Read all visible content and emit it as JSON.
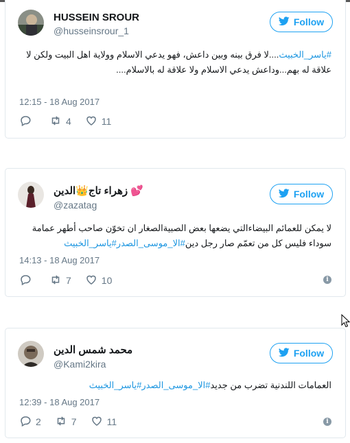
{
  "tweets": [
    {
      "name": "HUSSEIN SROUR",
      "handle": "@husseinsrour_1",
      "follow_label": "Follow",
      "text_hashtag": "#ياسر_الخبيث",
      "text_rest": "....لا فرق بينه وبين داعش، فهو يدعي الاسلام وولاية اهل البيت ولكن لا علاقة له بهم...وداعش يدعي الاسلام ولا علاقة له بالاسلام....",
      "timestamp": "12:15 - 18 Aug 2017",
      "replies": "",
      "retweets": "4",
      "likes": "11"
    },
    {
      "name": "زهراء تاج👑الدين",
      "name_emoji": "💕",
      "handle": "@zazatag",
      "follow_label": "Follow",
      "text_rest": "لا يمكن للعمائم البيضاءالتي يضعها بعض الصبيةالصغار ان تخوّن صاحب أطهر عمامة سوداء فليس كل من تعمّم صار رجل دين",
      "text_hashtags": "#الا_موسى_الصدر#ياسر_الخبيث",
      "timestamp": "14:13 - 18 Aug 2017",
      "replies": "",
      "retweets": "7",
      "likes": "10"
    },
    {
      "name": "محمد شمس الدين",
      "handle": "@Kami2kira",
      "follow_label": "Follow",
      "text_rest": "العمامات اللندنية تضرب من جديد",
      "text_hashtags": "#الا_موسى_الصدر#ياسر_الخبيث",
      "timestamp": "12:39 - 18 Aug 2017",
      "replies": "2",
      "retweets": "7",
      "likes": "11"
    }
  ],
  "colors": {
    "accent": "#1da1f2",
    "hashtag": "#1b95e0",
    "muted": "#657786",
    "border": "#e1e8ed"
  },
  "icons": [
    "twitter-bird-icon",
    "reply-icon",
    "retweet-icon",
    "heart-icon",
    "info-icon",
    "mouse-cursor-icon"
  ]
}
